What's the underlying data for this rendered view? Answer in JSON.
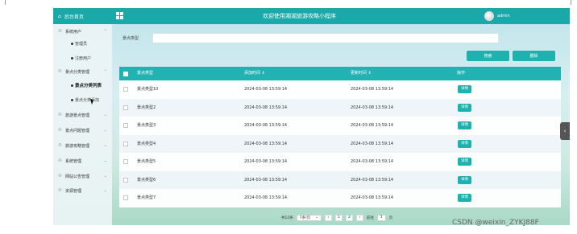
{
  "header": {
    "brand": "后台首页",
    "title": "欢迎使用湘湖旅游攻略小程序",
    "user": "admin"
  },
  "sidebar": {
    "items": [
      {
        "label": "系统用户",
        "expanded": true,
        "children": [
          {
            "label": "管理员"
          },
          {
            "label": "注册用户"
          }
        ]
      },
      {
        "label": "景点分类管理",
        "expanded": true,
        "children": [
          {
            "label": "景点分类列表",
            "active": true
          },
          {
            "label": "景点分类添加"
          }
        ]
      },
      {
        "label": "旅游景点管理"
      },
      {
        "label": "景点问题管理"
      },
      {
        "label": "旅游攻略管理"
      },
      {
        "label": "系统管理"
      },
      {
        "label": "网站公告管理"
      },
      {
        "label": "资源管理"
      }
    ]
  },
  "search": {
    "label": "景点类型",
    "value": ""
  },
  "toolbar": {
    "search_label": "搜索",
    "delete_label": "删除"
  },
  "table": {
    "columns": [
      "景点类型",
      "添加时间 ⇕",
      "更新时间 ⇕",
      "操作"
    ],
    "rows": [
      {
        "type": "景点类型10",
        "created": "2024-03-08 13:59:14",
        "updated": "2024-03-08 13:59:14",
        "action": "详情"
      },
      {
        "type": "景点类型2",
        "created": "2024-03-08 13:59:14",
        "updated": "2024-03-08 13:59:14",
        "action": "详情"
      },
      {
        "type": "景点类型3",
        "created": "2024-03-08 13:59:14",
        "updated": "2024-03-08 13:59:14",
        "action": "详情"
      },
      {
        "type": "景点类型4",
        "created": "2024-03-08 13:59:14",
        "updated": "2024-03-08 13:59:14",
        "action": "详情"
      },
      {
        "type": "景点类型5",
        "created": "2024-03-08 13:59:14",
        "updated": "2024-03-08 13:59:14",
        "action": "详情"
      },
      {
        "type": "景点类型6",
        "created": "2024-03-08 13:59:14",
        "updated": "2024-03-08 13:59:14",
        "action": "详情"
      },
      {
        "type": "景点类型7",
        "created": "2024-03-08 13:59:14",
        "updated": "2024-03-08 13:59:14",
        "action": "详情"
      }
    ]
  },
  "pagination": {
    "total": "共12条",
    "page_size": "7条/页",
    "prev": "‹",
    "pages": [
      "1",
      "2"
    ],
    "current": "2",
    "next": "›",
    "goto_label": "前往",
    "goto_value": "1",
    "page_suffix": "页"
  },
  "side_tab": {
    "icon": "chevron-left-icon",
    "glyph": "‹"
  },
  "watermark": "CSDN @weixin_ZYKJ88F",
  "colors": {
    "accent": "#1aa8a8",
    "button": "#1fb0b0"
  }
}
